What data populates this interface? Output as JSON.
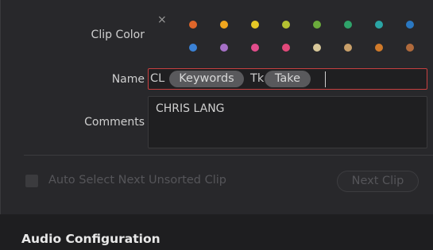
{
  "clip_color": {
    "label": "Clip Color",
    "clear_symbol": "×",
    "swatches_row1": [
      "#e0662a",
      "#f0a61e",
      "#e6c826",
      "#b5c232",
      "#6bab3c",
      "#2fa36a",
      "#2aa5a5",
      "#2a78c2"
    ],
    "swatches_row2": [
      "#3b82d6",
      "#a570c6",
      "#e24d8c",
      "#e2497a",
      "#d8c89a",
      "#c9a06a",
      "#d07a2a",
      "#b06a3c"
    ]
  },
  "name": {
    "label": "Name",
    "tokens": [
      {
        "text": "CL",
        "chip": false
      },
      {
        "text": "Keywords",
        "chip": true
      },
      {
        "text": "Tk",
        "chip": false
      },
      {
        "text": "Take",
        "chip": true
      }
    ]
  },
  "comments": {
    "label": "Comments",
    "value": "CHRIS LANG"
  },
  "auto_select": {
    "label": "Auto Select Next Unsorted Clip"
  },
  "next_clip": {
    "label": "Next Clip"
  },
  "audio_config": {
    "title": "Audio Configuration"
  }
}
